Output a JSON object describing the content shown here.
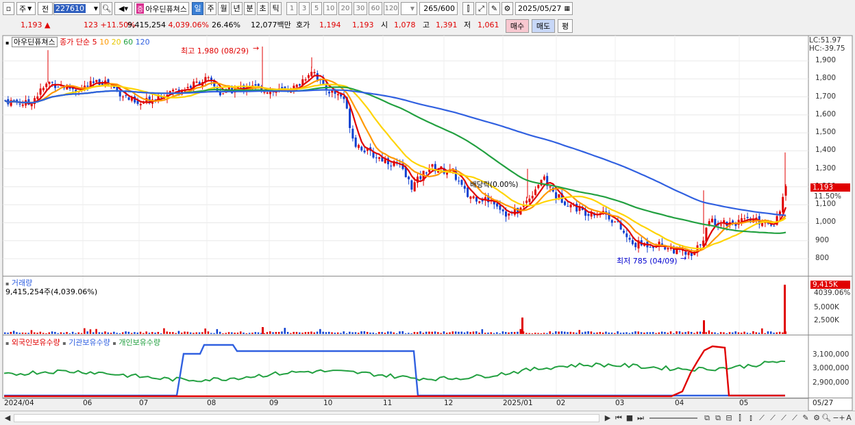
{
  "toolbar": {
    "market": "주",
    "prev_label": "전",
    "code": "227610",
    "stock_name": "아우딘퓨쳐스",
    "name_badge": "증",
    "periods": [
      "일",
      "주",
      "월",
      "년",
      "분",
      "초",
      "틱"
    ],
    "active_period": "일",
    "intervals": [
      "1",
      "3",
      "5",
      "10",
      "20",
      "30",
      "60",
      "120"
    ],
    "count": "265",
    "count_total": "/600",
    "date": "2025/05/27"
  },
  "quote": {
    "price": "1,193",
    "change": "123",
    "change_pct": "+11.50%",
    "volume": "9,415,254",
    "volume_pct": "4,039.06%",
    "turnover": "26.46%",
    "amount": "12,077백만",
    "hoga_label": "호가",
    "ask": "1,194",
    "bid": "1,193",
    "open_label": "시",
    "open": "1,078",
    "high_label": "고",
    "high": "1,391",
    "low_label": "저",
    "low": "1,061",
    "buy_label": "매수",
    "sell_label": "매도",
    "eval_label": "평"
  },
  "price_panel": {
    "title": "아우딘퓨쳐스",
    "ma_label": "종가 단순",
    "ma_periods": [
      "5",
      "10",
      "20",
      "60",
      "120"
    ],
    "ma_colors": [
      "#e00000",
      "#ff9900",
      "#ffd400",
      "#22a040",
      "#3060e0"
    ],
    "lc": "LC:51.97",
    "hc": "HC:-39.75",
    "y_ticks": [
      "1,900",
      "1,800",
      "1,700",
      "1,600",
      "1,500",
      "1,400",
      "1,300",
      "1,200",
      "1,100",
      "1,000",
      "900",
      "800"
    ],
    "last_price": "1,193",
    "last_pct": "11.50%",
    "annot_high": "최고 1,980 (08/29)",
    "annot_low": "최저 785 (04/09)",
    "annot_div": "배당락(0.00%)"
  },
  "volume_panel": {
    "title": "거래량",
    "value_line": "9,415,254주(4,039.06%)",
    "last_value": "9,415K",
    "last_pct": "4039.06%",
    "y_ticks": [
      "5,000K",
      "2,500K"
    ]
  },
  "holdings_panel": {
    "legend": [
      "외국인보유수량",
      "기관보유수량",
      "개인보유수량"
    ],
    "legend_colors": [
      "#e00000",
      "#3060e0",
      "#22a040"
    ],
    "y_ticks": [
      "3,100,000",
      "3,000,000",
      "2,900,000"
    ]
  },
  "x_axis": [
    "2024/04",
    "06",
    "07",
    "08",
    "09",
    "10",
    "11",
    "12",
    "2025/01",
    "02",
    "03",
    "04",
    "05",
    "05/27"
  ]
}
